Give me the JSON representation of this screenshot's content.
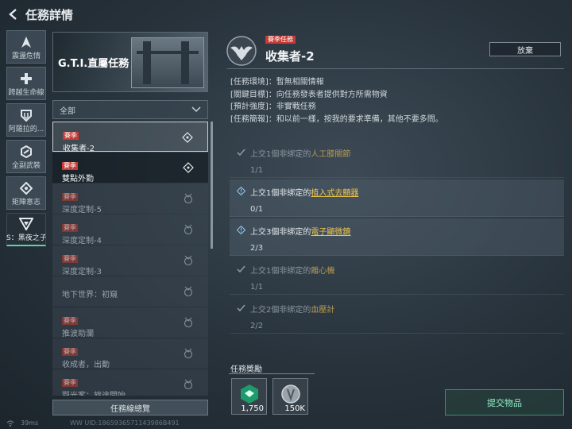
{
  "header": {
    "title": "任務詳情"
  },
  "nav": [
    {
      "label": "震盪危情",
      "icon": "arrow-up-icon"
    },
    {
      "label": "跨越生命線",
      "icon": "plus-icon"
    },
    {
      "label": "阿薩拉的...",
      "icon": "shield-icon"
    },
    {
      "label": "全副武裝",
      "icon": "hex-icon"
    },
    {
      "label": "矩陣意志",
      "icon": "diamond-icon"
    },
    {
      "label": "S：黑夜之子",
      "icon": "triangle-icon",
      "active": true
    }
  ],
  "banner": {
    "title": "G.T.I.直屬任務"
  },
  "filter": {
    "selected": "全部"
  },
  "quests": [
    {
      "tag": "賽季",
      "title": "收集者-2",
      "state": "selected"
    },
    {
      "tag": "賽季",
      "title": "雙點外勤",
      "state": "dark"
    },
    {
      "tag": "賽季",
      "title": "深度定制-5",
      "state": "dim"
    },
    {
      "tag": "賽季",
      "title": "深度定制-4",
      "state": "dim"
    },
    {
      "tag": "賽季",
      "title": "深度定制-3",
      "state": "dim"
    },
    {
      "tag": "",
      "title": "地下世界：初窺",
      "state": "dim"
    },
    {
      "tag": "賽季",
      "title": "推波助瀾",
      "state": "dim"
    },
    {
      "tag": "賽季",
      "title": "收成者，出動",
      "state": "dim"
    },
    {
      "tag": "賽季",
      "title": "觀光客：旅途開始",
      "state": "dim"
    }
  ],
  "overview_button": "任務線總覽",
  "status": {
    "ping": "39ms",
    "uid": "WW UID:1865936571143986B491"
  },
  "detail": {
    "season_tag": "賽季任務",
    "name": "收集者-2",
    "abandon": "放棄",
    "info": [
      "[任務環境]：暫無相關情報",
      "[關鍵目標]：向任務發表者提供對方所需物資",
      "[預計強度]：非實戰任務",
      "[任務簡報]：和以前一樣，按我的要求準備，其他不要多問。"
    ],
    "objectives": [
      {
        "prefix": "上交1個非綁定的",
        "item": "人工膝關節",
        "count": "1/1",
        "done": true
      },
      {
        "prefix": "上交1個非綁定的",
        "item": "植入式去顫器",
        "count": "0/1",
        "done": false
      },
      {
        "prefix": "上交3個非綁定的",
        "item": "電子顯微鏡",
        "count": "2/3",
        "done": false
      },
      {
        "prefix": "上交1個非綁定的",
        "item": "離心機",
        "count": "1/1",
        "done": true
      },
      {
        "prefix": "上交2個非綁定的",
        "item": "血壓計",
        "count": "2/2",
        "done": true
      }
    ],
    "reward_label": "任務獎勵",
    "rewards": [
      {
        "qty": "1,750",
        "icon": "badge-icon",
        "color": "#1e9a6c"
      },
      {
        "qty": "150K",
        "icon": "coin-icon",
        "color": "#9aa3aa"
      }
    ],
    "submit": "提交物品"
  }
}
